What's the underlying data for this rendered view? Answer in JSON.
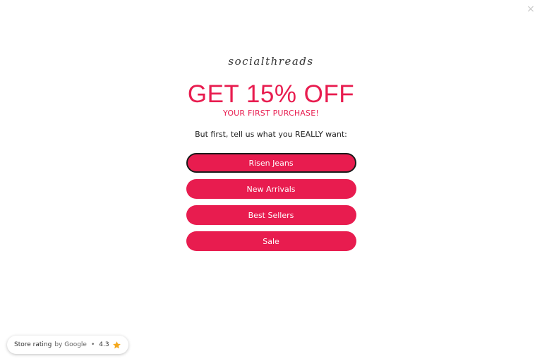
{
  "close": {
    "icon": "close-icon",
    "glyph": "×"
  },
  "popup": {
    "logo": "socialthreads",
    "headline": "GET 15% OFF",
    "subheadline": "YOUR FIRST PURCHASE!",
    "prompt": "But first, tell us what you REALLY want:",
    "options": [
      {
        "label": "Risen Jeans"
      },
      {
        "label": "New Arrivals"
      },
      {
        "label": "Best Sellers"
      },
      {
        "label": "Sale"
      }
    ],
    "accent_color": "#e81c4f"
  },
  "rating_badge": {
    "label": "Store rating",
    "by": "by Google",
    "separator": "•",
    "rating": "4.3",
    "star_color": "#f4a81d"
  }
}
